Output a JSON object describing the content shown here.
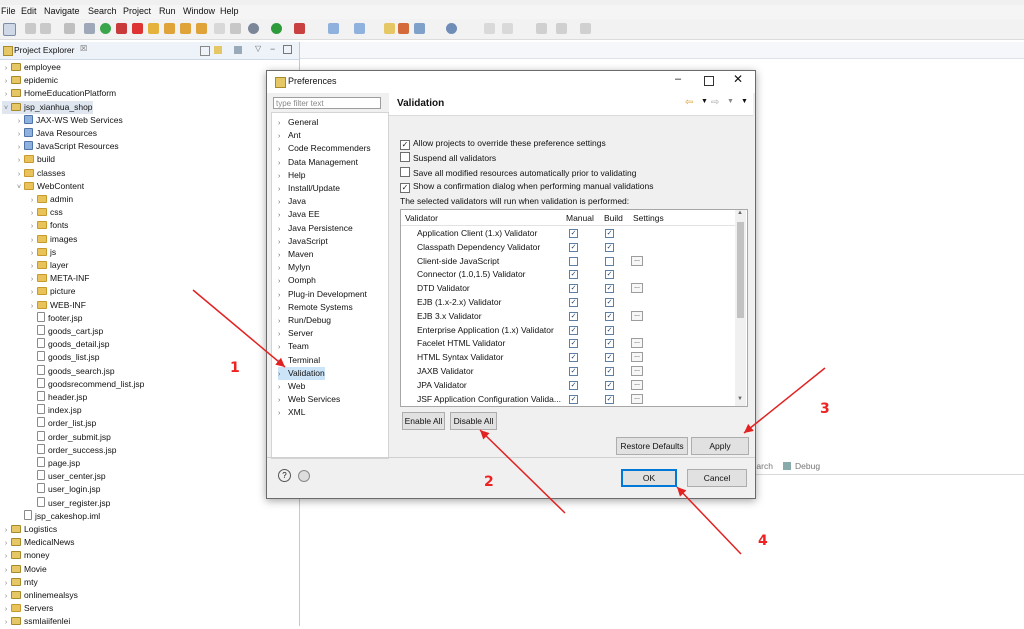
{
  "menu": [
    "File",
    "Edit",
    "Navigate",
    "Search",
    "Project",
    "Run",
    "Window",
    "Help"
  ],
  "explorer": {
    "title": "Project Explorer",
    "items": [
      {
        "label": "employee",
        "depth": 0,
        "icon": "project-icon",
        "tw": ">"
      },
      {
        "label": "epidemic",
        "depth": 0,
        "icon": "project-icon",
        "tw": ">"
      },
      {
        "label": "HomeEducationPlatform",
        "depth": 0,
        "icon": "project-icon",
        "tw": ">"
      },
      {
        "label": "jsp_xianhua_shop",
        "depth": 0,
        "icon": "project-icon",
        "tw": "v"
      },
      {
        "label": "JAX-WS Web Services",
        "depth": 1,
        "icon": "package-icon",
        "tw": ">"
      },
      {
        "label": "Java Resources",
        "depth": 1,
        "icon": "package-icon",
        "tw": ">"
      },
      {
        "label": "JavaScript Resources",
        "depth": 1,
        "icon": "package-icon",
        "tw": ">"
      },
      {
        "label": "build",
        "depth": 1,
        "icon": "folder-icon",
        "tw": ">"
      },
      {
        "label": "classes",
        "depth": 1,
        "icon": "folder-icon",
        "tw": ">"
      },
      {
        "label": "WebContent",
        "depth": 1,
        "icon": "folder-icon",
        "tw": "v"
      },
      {
        "label": "admin",
        "depth": 2,
        "icon": "folder-icon",
        "tw": ">"
      },
      {
        "label": "css",
        "depth": 2,
        "icon": "folder-icon",
        "tw": ">"
      },
      {
        "label": "fonts",
        "depth": 2,
        "icon": "folder-icon",
        "tw": ">"
      },
      {
        "label": "images",
        "depth": 2,
        "icon": "folder-icon",
        "tw": ">"
      },
      {
        "label": "js",
        "depth": 2,
        "icon": "folder-icon",
        "tw": ">"
      },
      {
        "label": "layer",
        "depth": 2,
        "icon": "folder-icon",
        "tw": ">"
      },
      {
        "label": "META-INF",
        "depth": 2,
        "icon": "folder-icon",
        "tw": ">"
      },
      {
        "label": "picture",
        "depth": 2,
        "icon": "folder-icon",
        "tw": ">"
      },
      {
        "label": "WEB-INF",
        "depth": 2,
        "icon": "folder-icon",
        "tw": ">"
      },
      {
        "label": "footer.jsp",
        "depth": 2,
        "icon": "file-icon",
        "tw": ""
      },
      {
        "label": "goods_cart.jsp",
        "depth": 2,
        "icon": "file-icon",
        "tw": ""
      },
      {
        "label": "goods_detail.jsp",
        "depth": 2,
        "icon": "file-icon",
        "tw": ""
      },
      {
        "label": "goods_list.jsp",
        "depth": 2,
        "icon": "file-icon",
        "tw": ""
      },
      {
        "label": "goods_search.jsp",
        "depth": 2,
        "icon": "file-icon",
        "tw": ""
      },
      {
        "label": "goodsrecommend_list.jsp",
        "depth": 2,
        "icon": "file-icon",
        "tw": ""
      },
      {
        "label": "header.jsp",
        "depth": 2,
        "icon": "file-icon",
        "tw": ""
      },
      {
        "label": "index.jsp",
        "depth": 2,
        "icon": "file-icon",
        "tw": ""
      },
      {
        "label": "order_list.jsp",
        "depth": 2,
        "icon": "file-icon",
        "tw": ""
      },
      {
        "label": "order_submit.jsp",
        "depth": 2,
        "icon": "file-icon",
        "tw": ""
      },
      {
        "label": "order_success.jsp",
        "depth": 2,
        "icon": "file-icon",
        "tw": ""
      },
      {
        "label": "page.jsp",
        "depth": 2,
        "icon": "file-icon",
        "tw": ""
      },
      {
        "label": "user_center.jsp",
        "depth": 2,
        "icon": "file-icon",
        "tw": ""
      },
      {
        "label": "user_login.jsp",
        "depth": 2,
        "icon": "file-icon",
        "tw": ""
      },
      {
        "label": "user_register.jsp",
        "depth": 2,
        "icon": "file-icon",
        "tw": ""
      },
      {
        "label": "jsp_cakeshop.iml",
        "depth": 1,
        "icon": "file-icon",
        "tw": ""
      },
      {
        "label": "Logistics",
        "depth": 0,
        "icon": "project-icon",
        "tw": ">"
      },
      {
        "label": "MedicalNews",
        "depth": 0,
        "icon": "project-icon",
        "tw": ">"
      },
      {
        "label": "money",
        "depth": 0,
        "icon": "project-icon",
        "tw": ">"
      },
      {
        "label": "Movie",
        "depth": 0,
        "icon": "project-icon",
        "tw": ">"
      },
      {
        "label": "mty",
        "depth": 0,
        "icon": "project-icon",
        "tw": ">"
      },
      {
        "label": "onlinemealsys",
        "depth": 0,
        "icon": "project-icon",
        "tw": ">"
      },
      {
        "label": "Servers",
        "depth": 0,
        "icon": "folder-icon",
        "tw": ">"
      },
      {
        "label": "ssmlaiifenlei",
        "depth": 0,
        "icon": "project-icon",
        "tw": ">"
      }
    ]
  },
  "console": {
    "search_tab": "Search",
    "debug_tab": "Debug"
  },
  "dialog": {
    "title": "Preferences",
    "filter_placeholder": "type filter text",
    "categories": [
      "General",
      "Ant",
      "Code Recommenders",
      "Data Management",
      "Help",
      "Install/Update",
      "Java",
      "Java EE",
      "Java Persistence",
      "JavaScript",
      "Maven",
      "Mylyn",
      "Oomph",
      "Plug-in Development",
      "Remote Systems",
      "Run/Debug",
      "Server",
      "Team",
      "Terminal",
      "Validation",
      "Web",
      "Web Services",
      "XML"
    ],
    "selected_category": "Validation",
    "page_title": "Validation",
    "options": [
      {
        "label": "Allow projects to override these preference settings",
        "checked": true
      },
      {
        "label": "Suspend all validators",
        "checked": false
      },
      {
        "label": "Save all modified resources automatically prior to validating",
        "checked": false
      },
      {
        "label": "Show a confirmation dialog when performing manual validations",
        "checked": true
      }
    ],
    "table_caption": "The selected validators will run when validation is performed:",
    "columns": [
      "Validator",
      "Manual",
      "Build",
      "Settings"
    ],
    "validators": [
      {
        "name": "Application Client (1.x) Validator",
        "manual": true,
        "build": true,
        "settings": false
      },
      {
        "name": "Classpath Dependency Validator",
        "manual": true,
        "build": true,
        "settings": false
      },
      {
        "name": "Client-side JavaScript",
        "manual": false,
        "build": false,
        "settings": true
      },
      {
        "name": "Connector (1.0,1.5) Validator",
        "manual": true,
        "build": true,
        "settings": false
      },
      {
        "name": "DTD Validator",
        "manual": true,
        "build": true,
        "settings": true
      },
      {
        "name": "EJB (1.x-2.x) Validator",
        "manual": true,
        "build": true,
        "settings": false
      },
      {
        "name": "EJB 3.x Validator",
        "manual": true,
        "build": true,
        "settings": true
      },
      {
        "name": "Enterprise Application (1.x) Validator",
        "manual": true,
        "build": true,
        "settings": false
      },
      {
        "name": "Facelet HTML Validator",
        "manual": true,
        "build": true,
        "settings": true
      },
      {
        "name": "HTML Syntax Validator",
        "manual": true,
        "build": true,
        "settings": true
      },
      {
        "name": "JAXB Validator",
        "manual": true,
        "build": true,
        "settings": true
      },
      {
        "name": "JPA Validator",
        "manual": true,
        "build": true,
        "settings": true
      },
      {
        "name": "JSF Application Configuration Valida...",
        "manual": true,
        "build": true,
        "settings": true
      }
    ],
    "buttons": {
      "enable_all": "Enable All",
      "disable_all": "Disable All",
      "restore_defaults": "Restore Defaults",
      "apply": "Apply",
      "ok": "OK",
      "cancel": "Cancel"
    }
  },
  "annotations": [
    "1",
    "2",
    "3",
    "4"
  ],
  "colors": {
    "arrow": "#e22222",
    "selection": "#cce4f7",
    "check": "#1d3f6b"
  }
}
